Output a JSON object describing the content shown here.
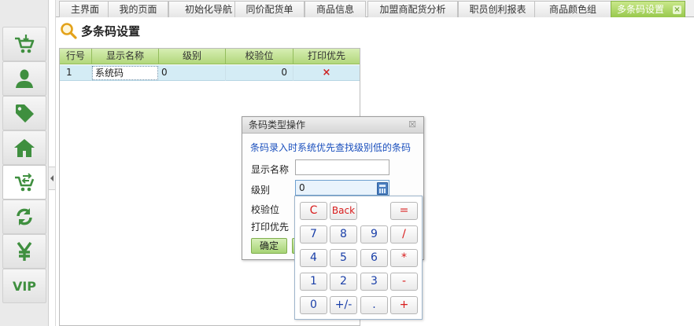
{
  "sidebar": {
    "items": [
      {
        "icon": "cart-in-icon"
      },
      {
        "icon": "user-icon"
      },
      {
        "icon": "tag-icon"
      },
      {
        "icon": "home-icon"
      },
      {
        "icon": "cart-transfer-icon"
      },
      {
        "icon": "refresh-icon"
      },
      {
        "icon": "yen-icon"
      },
      {
        "icon": "vip-icon",
        "label": "VIP"
      }
    ],
    "active_index": 4
  },
  "tabs": [
    {
      "label": "主界面"
    },
    {
      "label": "我的页面"
    },
    {
      "label": "初始化导航"
    },
    {
      "label": "同价配货单"
    },
    {
      "label": "商品信息"
    },
    {
      "label": "加盟商配货分析"
    },
    {
      "label": "职员创利报表"
    },
    {
      "label": "商品颜色组"
    },
    {
      "label": "多条码设置",
      "active": true
    }
  ],
  "page": {
    "title": "多条码设置"
  },
  "grid": {
    "columns": [
      "行号",
      "显示名称",
      "级别",
      "校验位",
      "打印优先"
    ],
    "rows": [
      {
        "row_no": "1",
        "display_name": "系统码",
        "level": "0",
        "check_digit": "0",
        "print_priority": "×"
      }
    ]
  },
  "dialog": {
    "title": "条码类型操作",
    "close": "☒",
    "hint": "条码录入时系统优先查找级别低的条码",
    "fields": {
      "display_name_label": "显示名称",
      "display_name_value": "",
      "level_label": "级别",
      "level_value": "0",
      "check_digit_label": "校验位",
      "print_priority_label": "打印优先"
    },
    "confirm_label": "确定"
  },
  "keypad": {
    "keys": [
      "C",
      "Back",
      "=",
      "7",
      "8",
      "9",
      "/",
      "4",
      "5",
      "6",
      "*",
      "1",
      "2",
      "3",
      "-",
      "0",
      "+/-",
      ".",
      "+"
    ]
  },
  "colors": {
    "accent_green": "#98c84d",
    "row_selected": "#d4ecf5",
    "hint_blue": "#1a4fbd",
    "key_blue": "#1a3fa8",
    "key_red": "#d81b1b"
  }
}
